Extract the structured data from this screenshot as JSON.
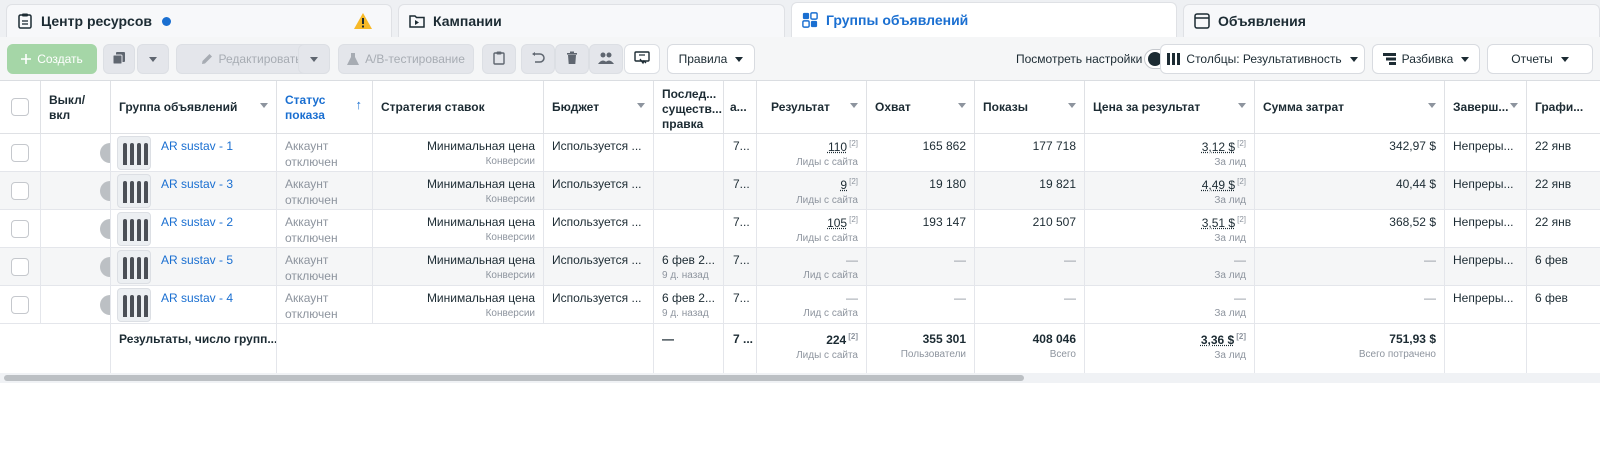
{
  "tabs": [
    {
      "label": "Центр ресурсов",
      "icon": "clipboard-icon"
    },
    {
      "label": "Кампании",
      "icon": "folder-icon"
    },
    {
      "label": "Группы объявлений",
      "icon": "grid-icon"
    },
    {
      "label": "Объявления",
      "icon": "ad-icon"
    }
  ],
  "toolbar": {
    "create": "Создать",
    "edit": "Редактировать",
    "ab_test": "A/B-тестирование",
    "rules": "Правила",
    "view_settings": "Посмотреть настройки",
    "columns": "Столбцы: Результативность",
    "breakdown": "Разбивка",
    "reports": "Отчеты"
  },
  "columns": {
    "toggle": "Выкл/ вкл",
    "adset": "Группа объявлений",
    "status": "Статус показа",
    "bid": "Стратегия ставок",
    "budget": "Бюджет",
    "last_edit": "Послед... существ... правка",
    "a": "а...",
    "result": "Результат",
    "reach": "Охват",
    "impressions": "Показы",
    "cpr": "Цена за результат",
    "spend": "Сумма затрат",
    "end": "Заверш...",
    "schedule": "Графи..."
  },
  "rows": [
    {
      "name": "AR sustav - 1",
      "status1": "Аккаунт",
      "status2": "отключен",
      "bid": "Минимальная цена",
      "bid_sub": "Конверсии",
      "budget": "Используется ...",
      "last_edit": "",
      "last_edit_sub": "",
      "a": "7...",
      "result": "110",
      "result_sub": "Лиды с сайта",
      "reach": "165 862",
      "impressions": "177 718",
      "cpr": "3,12 $",
      "cpr_sub": "За лид",
      "spend": "342,97 $",
      "end": "Непреры...",
      "schedule": "22 янв"
    },
    {
      "name": "AR sustav - 3",
      "status1": "Аккаунт",
      "status2": "отключен",
      "bid": "Минимальная цена",
      "bid_sub": "Конверсии",
      "budget": "Используется ...",
      "last_edit": "",
      "last_edit_sub": "",
      "a": "7...",
      "result": "9",
      "result_sub": "Лиды с сайта",
      "reach": "19 180",
      "impressions": "19 821",
      "cpr": "4,49 $",
      "cpr_sub": "За лид",
      "spend": "40,44 $",
      "end": "Непреры...",
      "schedule": "22 янв"
    },
    {
      "name": "AR sustav - 2",
      "status1": "Аккаунт",
      "status2": "отключен",
      "bid": "Минимальная цена",
      "bid_sub": "Конверсии",
      "budget": "Используется ...",
      "last_edit": "",
      "last_edit_sub": "",
      "a": "7...",
      "result": "105",
      "result_sub": "Лиды с сайта",
      "reach": "193 147",
      "impressions": "210 507",
      "cpr": "3,51 $",
      "cpr_sub": "За лид",
      "spend": "368,52 $",
      "end": "Непреры...",
      "schedule": "22 янв"
    },
    {
      "name": "AR sustav - 5",
      "status1": "Аккаунт",
      "status2": "отключен",
      "bid": "Минимальная цена",
      "bid_sub": "Конверсии",
      "budget": "Используется ...",
      "last_edit": "6 фев 2...",
      "last_edit_sub": "9 д. назад",
      "a": "7...",
      "result": "—",
      "result_sub": "Лид с сайта",
      "reach": "—",
      "impressions": "—",
      "cpr": "—",
      "cpr_sub": "За лид",
      "spend": "—",
      "end": "Непреры...",
      "schedule": "6 фев"
    },
    {
      "name": "AR sustav - 4",
      "status1": "Аккаунт",
      "status2": "отключен",
      "bid": "Минимальная цена",
      "bid_sub": "Конверсии",
      "budget": "Используется ...",
      "last_edit": "6 фев 2...",
      "last_edit_sub": "9 д. назад",
      "a": "7...",
      "result": "—",
      "result_sub": "Лид с сайта",
      "reach": "—",
      "impressions": "—",
      "cpr": "—",
      "cpr_sub": "За лид",
      "spend": "—",
      "end": "Непреры...",
      "schedule": "6 фев"
    }
  ],
  "totals": {
    "label": "Результаты, число групп...",
    "last_edit": "—",
    "a": "7 ...",
    "result": "224",
    "result_sub": "Лиды с сайта",
    "reach": "355 301",
    "reach_sub": "Пользователи",
    "impressions": "408 046",
    "impressions_sub": "Всего",
    "cpr": "3,36 $",
    "cpr_sub": "За лид",
    "spend": "751,93 $",
    "spend_sub": "Всего потрачено"
  },
  "footnote": "[2]",
  "colors": {
    "accent": "#1a6fd1",
    "toggle_on": "#1877f2",
    "create_bg": "#a5d6a7",
    "warning": "#f7b928"
  }
}
